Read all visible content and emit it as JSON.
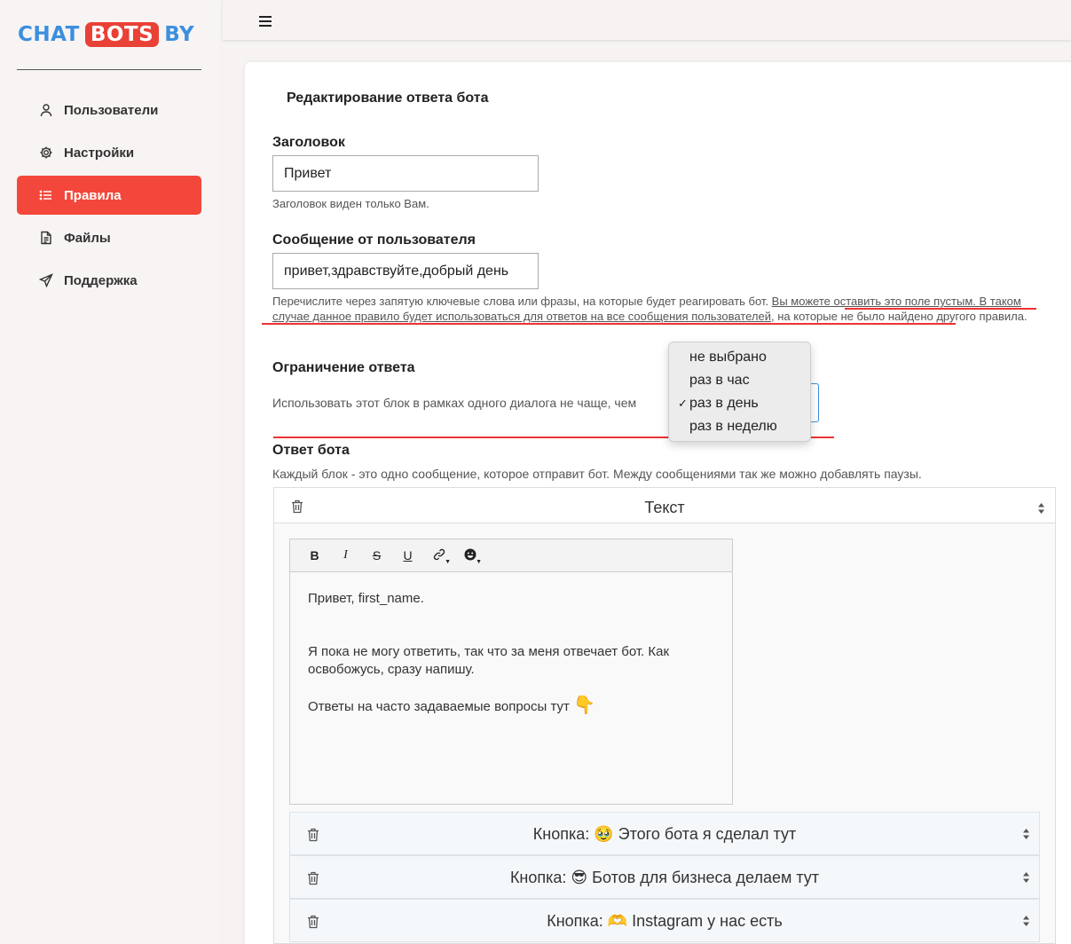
{
  "logo": {
    "part1": "CHAT",
    "part2": "BOTS",
    "part3": "BY"
  },
  "sidebar": {
    "items": [
      {
        "label": "Пользователи",
        "icon": "user-icon"
      },
      {
        "label": "Настройки",
        "icon": "gear-icon"
      },
      {
        "label": "Правила",
        "icon": "list-icon",
        "active": true
      },
      {
        "label": "Файлы",
        "icon": "file-icon"
      },
      {
        "label": "Поддержка",
        "icon": "send-icon"
      }
    ]
  },
  "colors": {
    "accent": "#f4473b",
    "logo_blue": "#3d8fde",
    "underline": "#e33333"
  },
  "form": {
    "title": "Редактирование ответа бота",
    "header_label": "Заголовок",
    "header_value": "Привет",
    "header_help": "Заголовок виден только Вам.",
    "message_label": "Сообщение от пользователя",
    "message_value": "привет,здравствуйте,добрый день",
    "message_help_1": "Перечислите через запятую ключевые слова или фразы, на которые будет реагировать бот. ",
    "message_help_2": "Вы можете оставить это поле пустым. В таком случае данное правило будет использоваться для ответов на все сообщения пользователей",
    "message_help_3": ", на которые не было найдено другого правила.",
    "limit_label": "Ограничение ответа",
    "limit_text": "Использовать этот блок в рамках одного диалога не чаще, чем",
    "limit_options": [
      "не выбрано",
      "раз в час",
      "раз в день",
      "раз в неделю"
    ],
    "limit_selected": "раз в день",
    "answer_label": "Ответ бота",
    "answer_help": "Каждый блок - это одно сообщение, которое отправит бот. Между сообщениями так же можно добавлять паузы."
  },
  "block": {
    "type_label": "Текст",
    "toolbar": [
      "B",
      "I",
      "S",
      "U",
      "link",
      "emoji"
    ],
    "text": {
      "line1": "Привет, first_name.",
      "line2": "Я пока не могу ответить, так что за меня отвечает бот. Как освобожусь, сразу напишу.",
      "line3": "Ответы на часто задаваемые вопросы тут",
      "line3_emoji": "👇"
    },
    "buttons": [
      "Кнопка: 🥹 Этого бота я сделал тут",
      "Кнопка: 😎 Ботов для бизнеса делаем тут",
      "Кнопка: 🫶 Instagram у нас есть"
    ]
  }
}
